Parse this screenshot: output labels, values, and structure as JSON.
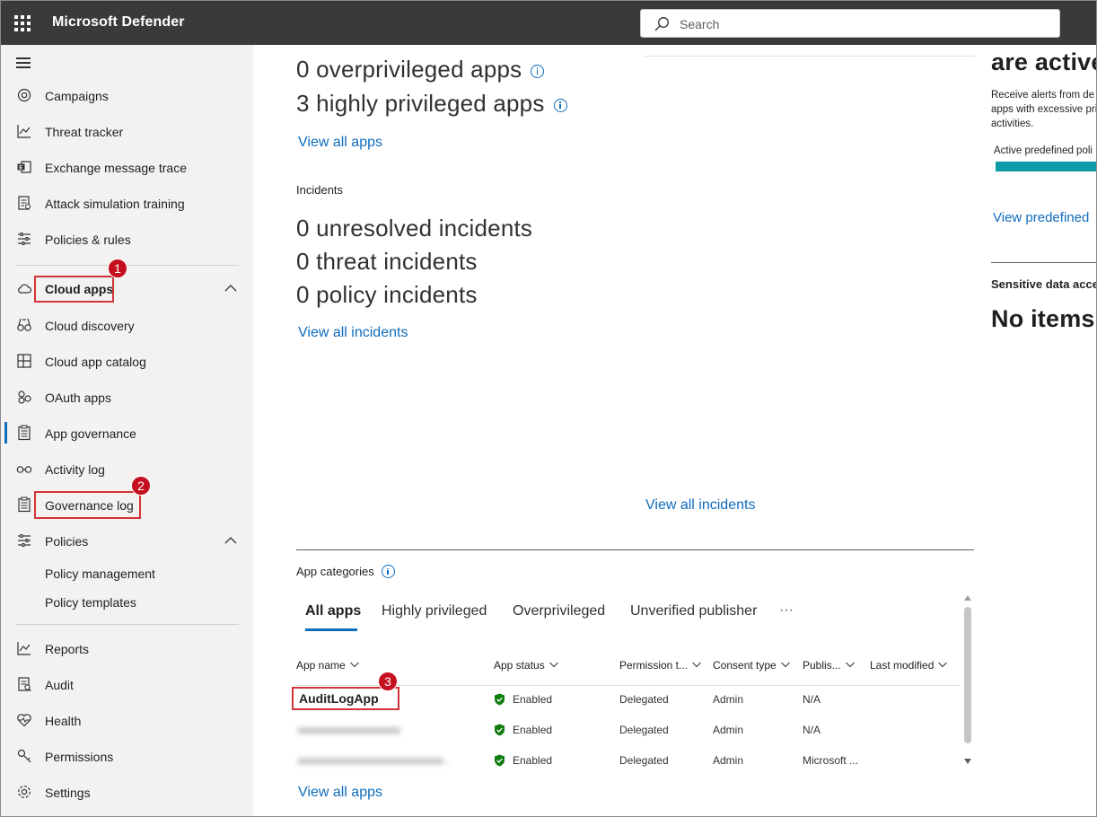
{
  "header": {
    "app_title": "Microsoft Defender",
    "search_placeholder": "Search"
  },
  "sidebar": {
    "items": [
      {
        "label": "Campaigns",
        "icon": "target-icon"
      },
      {
        "label": "Threat tracker",
        "icon": "chart-icon"
      },
      {
        "label": "Exchange message trace",
        "icon": "exchange-icon"
      },
      {
        "label": "Attack simulation training",
        "icon": "clipboard-icon"
      },
      {
        "label": "Policies & rules",
        "icon": "sliders-icon"
      },
      {
        "label": "Cloud apps",
        "icon": "cloud-icon"
      },
      {
        "label": "Cloud discovery",
        "icon": "binoculars-icon"
      },
      {
        "label": "Cloud app catalog",
        "icon": "catalog-icon"
      },
      {
        "label": "OAuth apps",
        "icon": "oauth-icon"
      },
      {
        "label": "App governance",
        "icon": "clipboard-icon"
      },
      {
        "label": "Activity log",
        "icon": "glasses-icon"
      },
      {
        "label": "Governance log",
        "icon": "clipboard-icon"
      },
      {
        "label": "Policies",
        "icon": "sliders-icon"
      },
      {
        "label": "Policy management"
      },
      {
        "label": "Policy templates"
      },
      {
        "label": "Reports",
        "icon": "chart-icon"
      },
      {
        "label": "Audit",
        "icon": "audit-icon"
      },
      {
        "label": "Health",
        "icon": "heart-icon"
      },
      {
        "label": "Permissions",
        "icon": "key-icon"
      },
      {
        "label": "Settings",
        "icon": "gear-icon"
      }
    ],
    "badges": [
      "1",
      "2",
      "3"
    ]
  },
  "overview": {
    "overprivileged": "0 overprivileged apps",
    "highly_privileged": "3 highly privileged apps",
    "view_all_apps": "View all apps",
    "incidents_heading": "Incidents",
    "unresolved": "0 unresolved incidents",
    "threat": "0 threat incidents",
    "policy": "0 policy incidents",
    "view_all_incidents": "View all incidents",
    "view_all_incidents_2": "View all incidents"
  },
  "right_panel": {
    "heading": "are active",
    "description": "Receive alerts from de apps with excessive pri activities.",
    "bar_label": "Active predefined poli",
    "link": "View predefined",
    "sensitive_heading": "Sensitive data acce",
    "no_items": "No items"
  },
  "categories": {
    "heading": "App categories",
    "tabs": [
      "All apps",
      "Highly privileged",
      "Overprivileged",
      "Unverified publisher"
    ],
    "more": "···",
    "columns": [
      "App name",
      "App status",
      "Permission t...",
      "Consent type",
      "Publis...",
      "Last modified"
    ],
    "rows": [
      {
        "name": "AuditLogApp",
        "status": "Enabled",
        "permission": "Delegated",
        "consent": "Admin",
        "publisher": "N/A"
      },
      {
        "name": "xxxxxxxxxxxxxxxxxxx",
        "status": "Enabled",
        "permission": "Delegated",
        "consent": "Admin",
        "publisher": "N/A"
      },
      {
        "name": "xxxxxxxxxxxxxxxxxxxxxxxxxxx .",
        "status": "Enabled",
        "permission": "Delegated",
        "consent": "Admin",
        "publisher": "Microsoft ..."
      }
    ],
    "view_all_apps": "View all apps"
  },
  "colors": {
    "accent": "#0f6cbd",
    "topbar": "#3b3a39",
    "callout": "#d13438",
    "status_green": "#107c10"
  }
}
